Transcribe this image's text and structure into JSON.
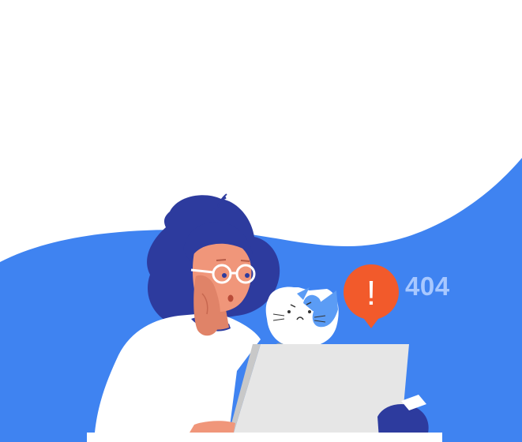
{
  "error": {
    "code": "404",
    "alert_symbol": "!",
    "alert_icon": "exclamation-icon"
  },
  "colors": {
    "background": "#ffffff",
    "wave_blue": "#3f83f1",
    "hair_navy": "#2d3b9e",
    "skin": "#f0967a",
    "shirt": "#ffffff",
    "alert_orange": "#f25a2b",
    "code_text": "#a8c8ff",
    "laptop_gray": "#e6e6e6",
    "cat_patch": "#5b9cf5"
  }
}
